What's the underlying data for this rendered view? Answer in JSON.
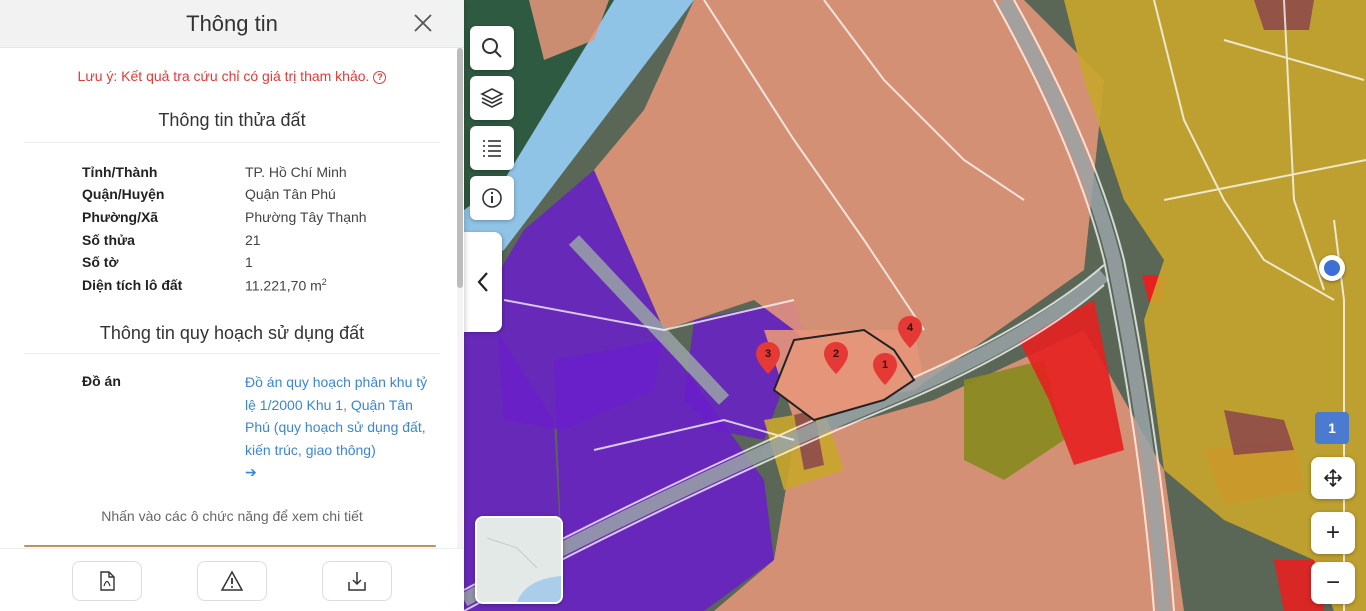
{
  "panel": {
    "title": "Thông tin",
    "warning": "Lưu ý: Kết quả tra cứu chỉ có giá trị tham khảo.",
    "parcel_section_title": "Thông tin thửa đất",
    "parcel_rows": [
      {
        "label": "Tỉnh/Thành",
        "value": "TP. Hồ Chí Minh"
      },
      {
        "label": "Quận/Huyện",
        "value": "Quận Tân Phú"
      },
      {
        "label": "Phường/Xã",
        "value": "Phường Tây Thạnh"
      },
      {
        "label": "Số thửa",
        "value": "21"
      },
      {
        "label": "Số tờ",
        "value": "1"
      },
      {
        "label": "Diện tích lô đất",
        "value": "11.221,70 m",
        "unit_sup": "2"
      }
    ],
    "planning_section_title": "Thông tin quy hoạch sử dụng đất",
    "plan_label": "Đồ án",
    "plan_link": "Đồ án quy hoạch phân khu tỷ lệ 1/2000 Khu 1, Quận Tân Phú (quy hoạch sử dụng đất, kiến trúc, giao thông)",
    "plan_arrow": "➔",
    "hint": "Nhấn vào các ô chức năng để xem chi tiết",
    "footer_icons": [
      "pdf-file-icon",
      "warning-icon",
      "download-icon"
    ]
  },
  "map": {
    "tools": [
      "search-icon",
      "layers-icon",
      "list-icon",
      "info-icon"
    ],
    "markers": [
      "1",
      "2",
      "3",
      "4"
    ],
    "page_badge": "1",
    "zoom_in": "+",
    "zoom_out": "−",
    "colors": {
      "residential": "#c9a62c",
      "industrial": "#e5967a",
      "commercial_purple": "#6a1fc9",
      "red_zone": "#e62020",
      "green_zone": "#8a8a22",
      "canal": "#8ec8f0",
      "brown": "#8e4a4a"
    }
  }
}
